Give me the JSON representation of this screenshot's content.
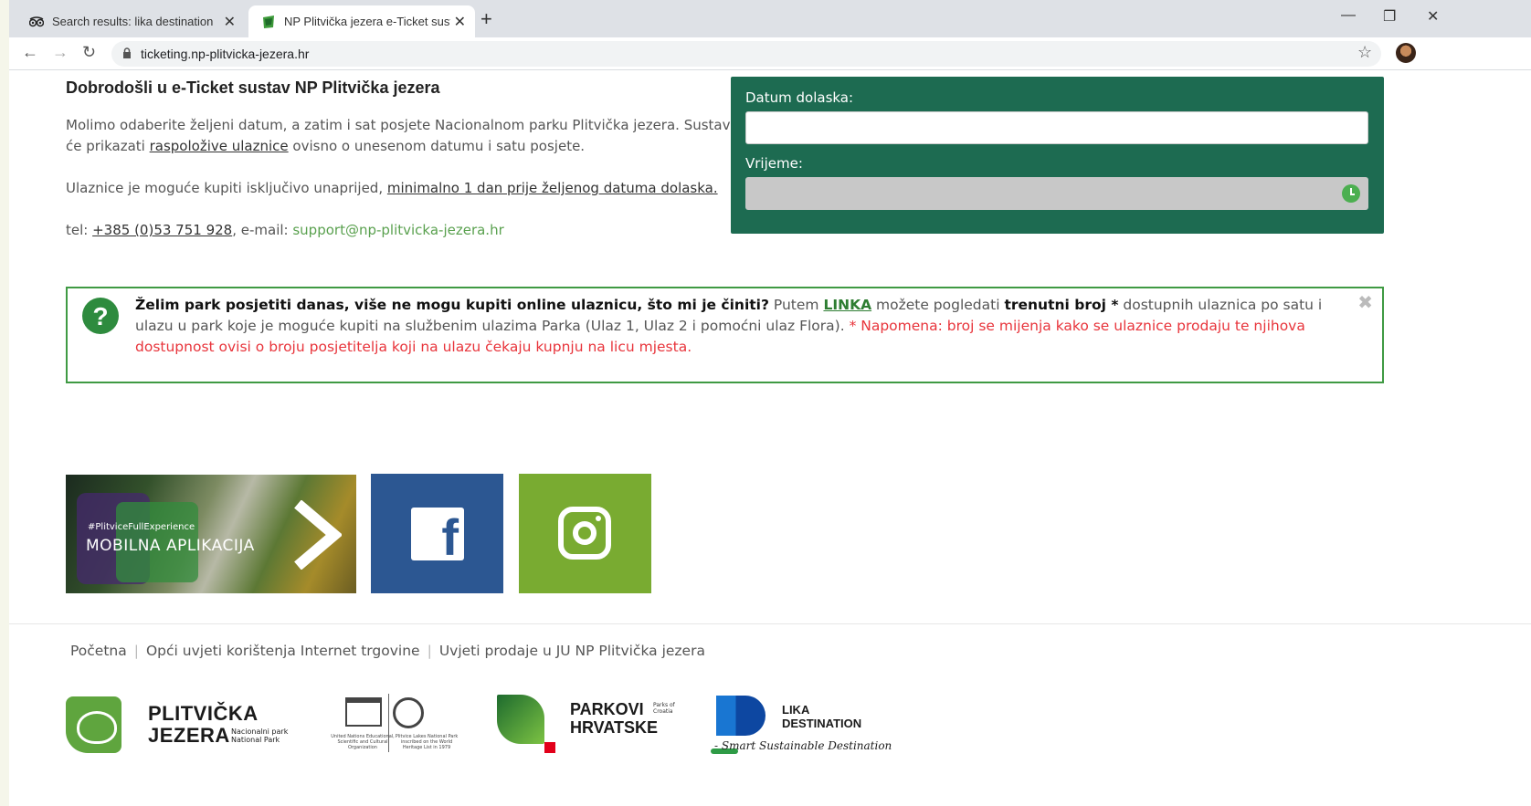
{
  "browser": {
    "tabs": [
      {
        "title": "Search results: lika destination - T",
        "active": false
      },
      {
        "title": "NP Plitvička jezera e-Ticket sustav",
        "active": true
      }
    ],
    "url": "ticketing.np-plitvicka-jezera.hr"
  },
  "intro": {
    "heading": "Dobrodošli u e-Ticket sustav NP Plitvička jezera",
    "p1_before": "Molimo odaberite željeni datum, a zatim i sat posjete Nacionalnom parku Plitvička jezera. Sustav će prikazati ",
    "p1_link": "raspoložive ulaznice",
    "p1_after": " ovisno o unesenom datumu i satu posjete.",
    "p2_before": "Ulaznice je moguće kupiti isključivo unaprijed, ",
    "p2_link": "minimalno 1 dan prije željenog datuma dolaska.",
    "tel_label": "tel: ",
    "tel": "+385 (0)53 751 928",
    "email_label": ", e-mail: ",
    "email": "support@np-plitvicka-jezera.hr"
  },
  "form": {
    "date_label": "Datum dolaska:",
    "date_value": "",
    "time_label": "Vrijeme:",
    "time_value": ""
  },
  "notice": {
    "question": "Želim park posjetiti danas, više ne mogu kupiti online ulaznicu, što mi je činiti?",
    "t1": " Putem ",
    "link": "LINKA",
    "t2": " možete pogledati ",
    "bold2": "trenutni broj *",
    "t3": " dostupnih ulaznica po satu i ulazu u park koje je moguće kupiti na službenim ulazima Parka (Ulaz 1, Ulaz 2 i pomoćni ulaz Flora). ",
    "red": "* Napomena: broj se mijenja kako se ulaznice prodaju te njihova dostupnost ovisi o broju posjetitelja koji na ulazu čekaju kupnju na licu mjesta."
  },
  "tiles": {
    "app_hashtag": "#PlitviceFullExperience",
    "app_title": "MOBILNA APLIKACIJA"
  },
  "footer": {
    "links": [
      "Početna",
      "Opći uvjeti korištenja Internet trgovine",
      "Uvjeti prodaje u JU NP Plitvička jezera"
    ]
  },
  "logos": {
    "plitvice_line1": "PLITVIČKA",
    "plitvice_line2": "JEZERA",
    "plitvice_sub1": "Nacionalni park",
    "plitvice_sub2": "National Park",
    "unesco_left": "United Nations Educational, Scientific and Cultural Organization",
    "unesco_right": "Plitvice Lakes National Park inscribed on the World Heritage List in 1979",
    "parkovi_line1": "PARKOVI",
    "parkovi_line2": "HRVATSKE",
    "parkovi_sub": "Parks of Croatia",
    "lika_line1": "LIKA",
    "lika_line2": "DESTINATION",
    "lika_tag": "- Smart Sustainable Destination"
  },
  "colors": {
    "brand_green": "#1d6b51",
    "notice_border": "#3f9a43",
    "alert_red": "#e8343b",
    "facebook_blue": "#2c5792",
    "instagram_green": "#79ab31"
  }
}
